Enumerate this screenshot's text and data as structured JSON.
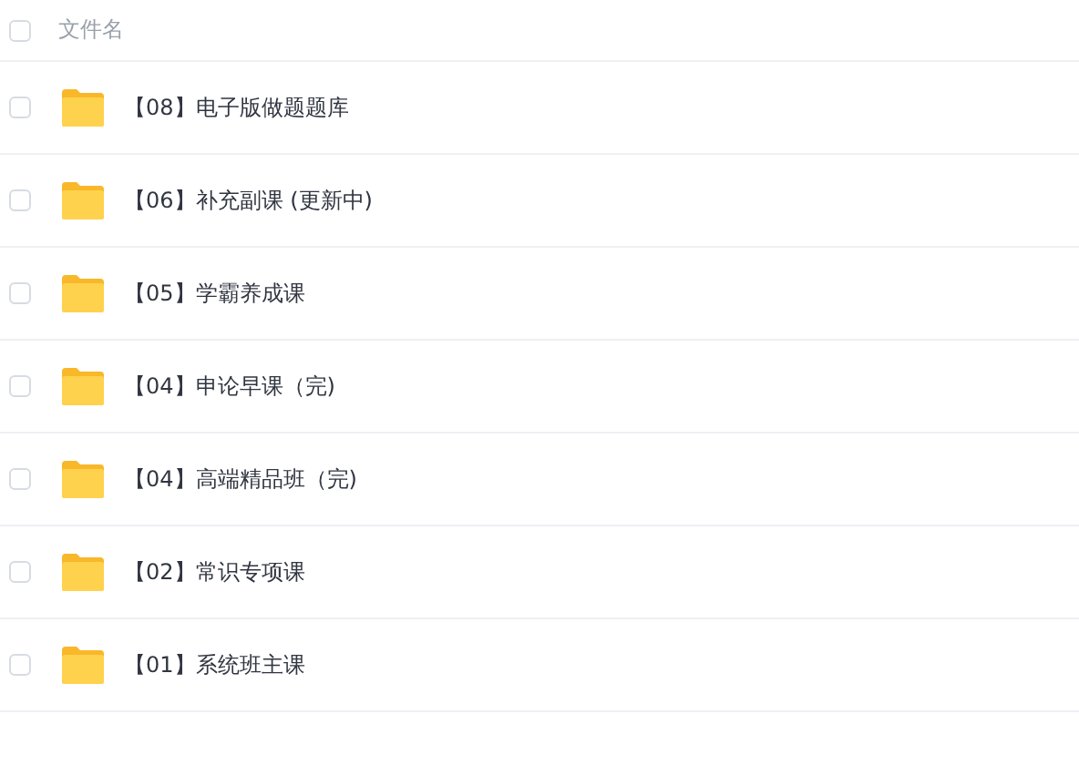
{
  "header": {
    "column_label": "文件名",
    "checked": false
  },
  "files": [
    {
      "name": "【08】电子版做题题库",
      "checked": false
    },
    {
      "name": "【06】补充副课 (更新中)",
      "checked": false
    },
    {
      "name": "【05】学霸养成课",
      "checked": false
    },
    {
      "name": "【04】申论早课（完)",
      "checked": false
    },
    {
      "name": "【04】高端精品班（完)",
      "checked": false
    },
    {
      "name": "【02】常识专项课",
      "checked": false
    },
    {
      "name": "【01】系统班主课",
      "checked": false
    }
  ]
}
